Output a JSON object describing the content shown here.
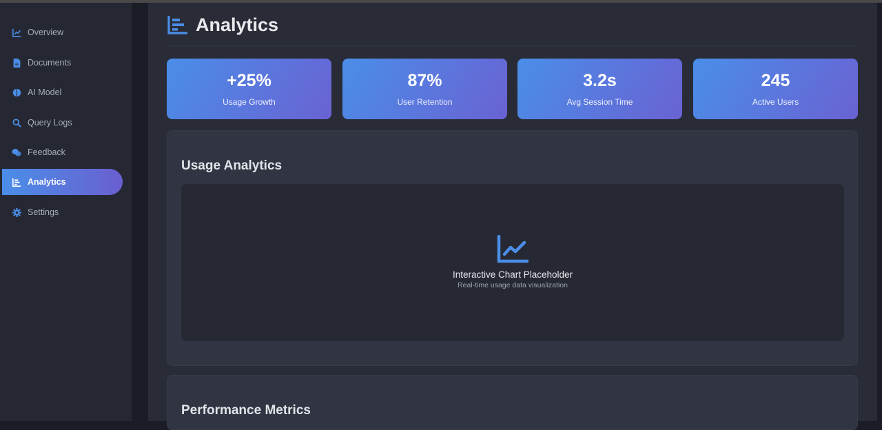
{
  "sidebar": {
    "items": [
      {
        "label": "Overview",
        "icon": "chart-line-icon"
      },
      {
        "label": "Documents",
        "icon": "document-icon"
      },
      {
        "label": "AI Model",
        "icon": "brain-icon"
      },
      {
        "label": "Query Logs",
        "icon": "search-icon"
      },
      {
        "label": "Feedback",
        "icon": "comments-icon"
      },
      {
        "label": "Analytics",
        "icon": "bar-chart-icon",
        "active": true
      },
      {
        "label": "Settings",
        "icon": "gear-icon"
      }
    ]
  },
  "page": {
    "title": "Analytics"
  },
  "stats": [
    {
      "value": "+25%",
      "label": "Usage Growth"
    },
    {
      "value": "87%",
      "label": "User Retention"
    },
    {
      "value": "3.2s",
      "label": "Avg Session Time"
    },
    {
      "value": "245",
      "label": "Active Users"
    }
  ],
  "usage_panel": {
    "title": "Usage Analytics",
    "chart_title": "Interactive Chart Placeholder",
    "chart_subtitle": "Real-time usage data visualization"
  },
  "performance_panel": {
    "title": "Performance Metrics"
  },
  "colors": {
    "accent": "#4a8ee8",
    "gradient_end": "#6a62d3",
    "background": "#292c37",
    "sidebar": "#252833"
  }
}
